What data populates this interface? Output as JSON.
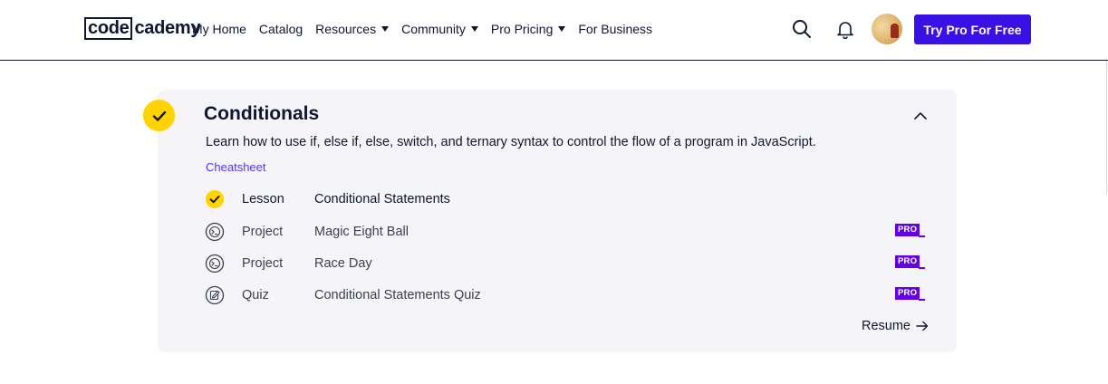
{
  "header": {
    "logo": {
      "part1": "code",
      "part2": "cademy"
    },
    "nav": [
      {
        "label": "My Home",
        "has_dropdown": false
      },
      {
        "label": "Catalog",
        "has_dropdown": false
      },
      {
        "label": "Resources",
        "has_dropdown": true
      },
      {
        "label": "Community",
        "has_dropdown": true
      },
      {
        "label": "Pro Pricing",
        "has_dropdown": true
      },
      {
        "label": "For Business",
        "has_dropdown": false
      }
    ],
    "search_icon": "search-icon",
    "notifications_icon": "bell-icon",
    "cta_label": "Try Pro For Free",
    "cta_color": "#3a10e5"
  },
  "module": {
    "completed": true,
    "title": "Conditionals",
    "description": "Learn how to use if, else if, else, switch, and ternary syntax to control the flow of a program in JavaScript.",
    "cheatsheet_label": "Cheatsheet",
    "items": [
      {
        "type": "Lesson",
        "title": "Conditional Statements",
        "status": "completed",
        "icon": "check-circle-icon",
        "pro": false
      },
      {
        "type": "Project",
        "title": "Magic Eight Ball",
        "status": "not-started",
        "icon": "project-icon",
        "pro": true,
        "pro_label": "PRO"
      },
      {
        "type": "Project",
        "title": "Race Day",
        "status": "not-started",
        "icon": "project-icon",
        "pro": true,
        "pro_label": "PRO"
      },
      {
        "type": "Quiz",
        "title": "Conditional Statements Quiz",
        "status": "not-started",
        "icon": "quiz-icon",
        "pro": true,
        "pro_label": "PRO"
      }
    ],
    "resume_label": "Resume"
  },
  "colors": {
    "brand_purple": "#3a10e5",
    "pro_purple": "#6400e4",
    "link_purple": "#5533ff",
    "completed_yellow": "#ffd300",
    "card_bg": "#f5f4f8",
    "navy": "#10162f"
  }
}
